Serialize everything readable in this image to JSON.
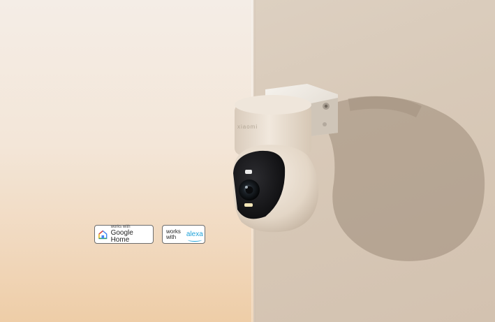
{
  "camera": {
    "brand_text": "xiaomi"
  },
  "badges": {
    "google": {
      "line1": "works with",
      "line2": "Google Home"
    },
    "alexa": {
      "line1": "works",
      "line2": "with",
      "brand": "alexa"
    }
  }
}
